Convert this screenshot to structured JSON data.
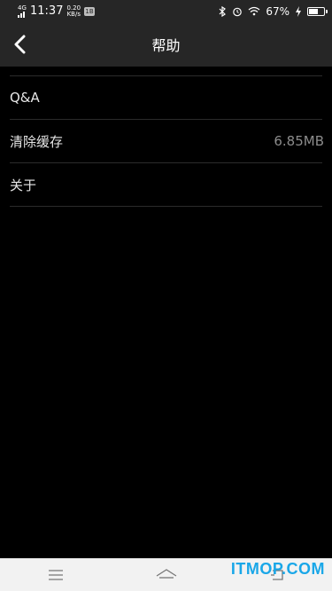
{
  "status_bar": {
    "network": "4G",
    "time": "11:37",
    "speed_value": "0.20",
    "speed_unit": "KB/s",
    "badge": "1B",
    "battery": "67%",
    "battery_level": 0.67
  },
  "header": {
    "title": "帮助",
    "back_icon": "chevron-left-icon"
  },
  "menu": {
    "items": [
      {
        "label": "Q&A",
        "value": ""
      },
      {
        "label": "清除缓存",
        "value": "6.85MB"
      },
      {
        "label": "关于",
        "value": ""
      }
    ]
  },
  "bottom_nav": {
    "menu_icon": "menu-icon",
    "home_icon": "home-icon",
    "back_icon": "back-icon"
  },
  "watermark": {
    "text": "ITMOP.COM",
    "color": "#1aa7e8"
  },
  "colors": {
    "background": "#000000",
    "bar": "#262626",
    "divider": "#2b2b2b"
  }
}
